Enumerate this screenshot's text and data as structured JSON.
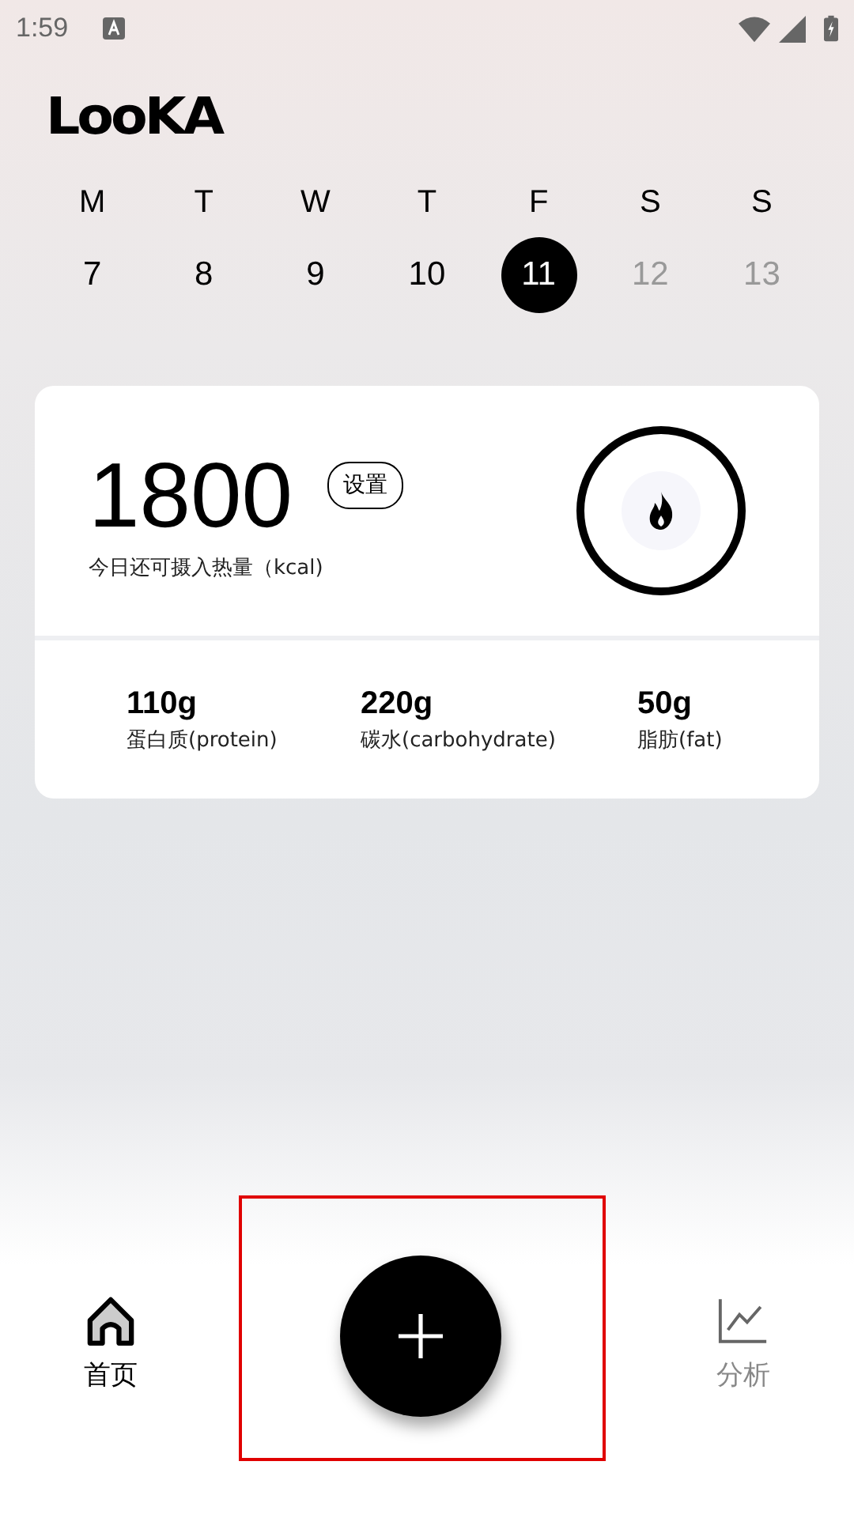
{
  "status_bar": {
    "time": "1:59"
  },
  "logo": "LooKA",
  "week": [
    {
      "letter": "M",
      "date": "7",
      "selected": false,
      "disabled": false
    },
    {
      "letter": "T",
      "date": "8",
      "selected": false,
      "disabled": false
    },
    {
      "letter": "W",
      "date": "9",
      "selected": false,
      "disabled": false
    },
    {
      "letter": "T",
      "date": "10",
      "selected": false,
      "disabled": false
    },
    {
      "letter": "F",
      "date": "11",
      "selected": true,
      "disabled": false
    },
    {
      "letter": "S",
      "date": "12",
      "selected": false,
      "disabled": true
    },
    {
      "letter": "S",
      "date": "13",
      "selected": false,
      "disabled": true
    }
  ],
  "calorie_card": {
    "value": "1800",
    "set_button": "设置",
    "caption": "今日还可摄入热量（kcal)",
    "macros": [
      {
        "amount": "110g",
        "label": "蛋白质(protein)"
      },
      {
        "amount": "220g",
        "label": "碳水(carbohydrate)"
      },
      {
        "amount": "50g",
        "label": "脂肪(fat)"
      }
    ]
  },
  "add_button": {
    "highlighted": true
  },
  "bottom_nav": [
    {
      "kind": "home",
      "label": "首页",
      "selected": true
    },
    {
      "kind": "chart",
      "label": "分析",
      "selected": false
    }
  ]
}
